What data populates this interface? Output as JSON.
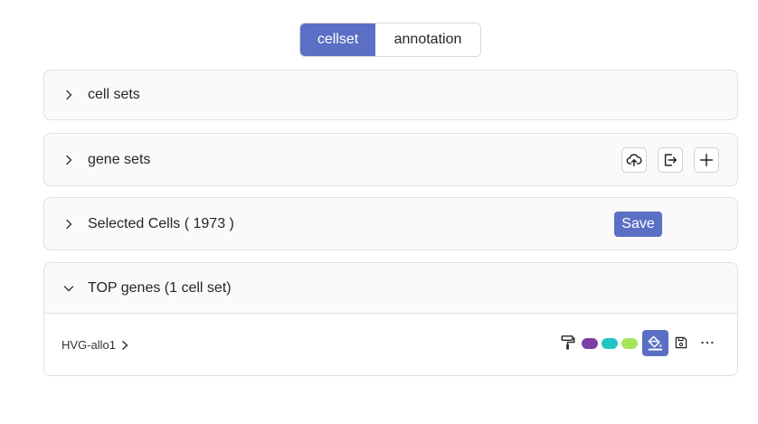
{
  "tabs": {
    "active_label": "cellset",
    "inactive_label": "annotation"
  },
  "panels": {
    "cell_sets": {
      "title": "cell sets"
    },
    "gene_sets": {
      "title": "gene sets"
    },
    "selected_cells": {
      "title": "Selected Cells ( 1973 )",
      "save_label": "Save"
    },
    "top_genes": {
      "title": "TOP genes (1 cell set)",
      "row_label": "HVG-allo1"
    }
  },
  "icons": {
    "upload": "cloud-upload-icon",
    "export": "export-icon",
    "add": "plus-icon",
    "roller": "paint-roller-icon",
    "fill": "paint-bucket-icon",
    "save": "floppy-disk-icon",
    "more": "ellipsis-icon"
  },
  "colors": {
    "accent": "#5b6fc4",
    "swatch_1": "#7b3fa8",
    "swatch_2": "#25c4c4",
    "swatch_3": "#a6e55a"
  }
}
